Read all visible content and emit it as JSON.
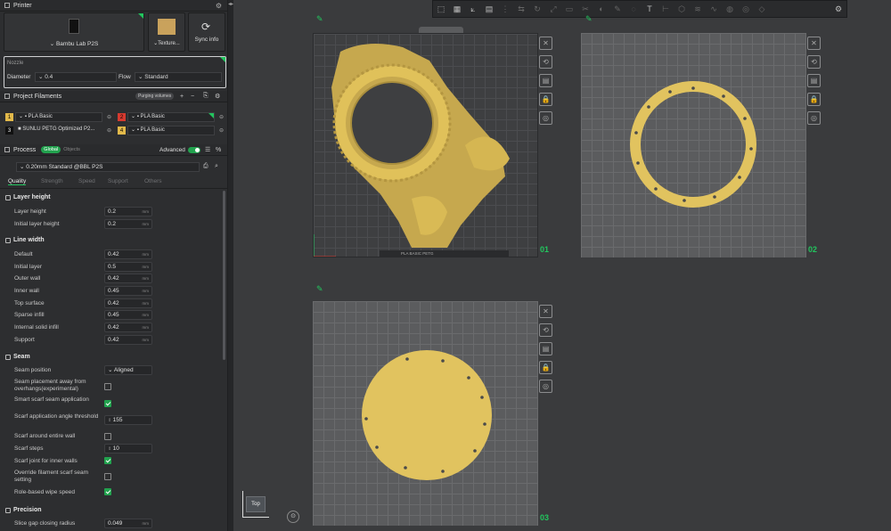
{
  "printer": {
    "section_title": "Printer",
    "model": "Bambu Lab P2S",
    "plate": "Texture...",
    "sync_label": "Sync info"
  },
  "nozzle": {
    "title": "Nozzle",
    "diameter_label": "Diameter",
    "diameter_value": "0.4",
    "flow_label": "Flow",
    "flow_value": "Standard"
  },
  "filaments": {
    "title": "Project Filaments",
    "badge": "Purging volumes",
    "items": [
      {
        "num": "1",
        "name": "PLA Basic",
        "color": "#e2b94a"
      },
      {
        "num": "2",
        "name": "PLA Basic",
        "color": "#d63a2f"
      },
      {
        "num": "3",
        "name": "SUNLU PETG Optimized P2...",
        "color": "#111111"
      },
      {
        "num": "4",
        "name": "PLA Basic",
        "color": "#e2b94a"
      }
    ]
  },
  "process": {
    "title": "Process",
    "global": "Global",
    "objects": "Objects",
    "advanced": "Advanced",
    "profile": "0.20mm Standard @BBL P2S",
    "tabs": [
      "Quality",
      "Strength",
      "Speed",
      "Support",
      "Others"
    ]
  },
  "layer_height": {
    "title": "Layer height",
    "layer_height_label": "Layer height",
    "layer_height": "0.2",
    "initial_label": "Initial layer height",
    "initial": "0.2"
  },
  "line_width": {
    "title": "Line width",
    "rows": [
      {
        "label": "Default",
        "value": "0.42"
      },
      {
        "label": "Initial layer",
        "value": "0.5"
      },
      {
        "label": "Outer wall",
        "value": "0.42"
      },
      {
        "label": "Inner wall",
        "value": "0.45"
      },
      {
        "label": "Top surface",
        "value": "0.42"
      },
      {
        "label": "Sparse infill",
        "value": "0.45"
      },
      {
        "label": "Internal solid infill",
        "value": "0.42"
      },
      {
        "label": "Support",
        "value": "0.42"
      }
    ]
  },
  "unit": "mm",
  "seam": {
    "title": "Seam",
    "position_label": "Seam position",
    "position_value": "Aligned",
    "away_label": "Seam placement away from overhangs(experimental)",
    "smart_label": "Smart scarf seam application",
    "angle_label": "Scarf application angle threshold",
    "angle_value": "155",
    "around_label": "Scarf around entire wall",
    "steps_label": "Scarf steps",
    "steps_value": "10",
    "inner_label": "Scarf joint for inner walls",
    "override_label": "Override filament scarf seam setting",
    "role_label": "Role-based wipe speed"
  },
  "precision": {
    "title": "Precision",
    "closing_label": "Slice gap closing radius",
    "closing_value": "0.049"
  },
  "viewport": {
    "plate1": "01",
    "plate2": "02",
    "plate3": "03",
    "view_label": "Top",
    "plate1_filament": "PLA BASIC PETG"
  }
}
